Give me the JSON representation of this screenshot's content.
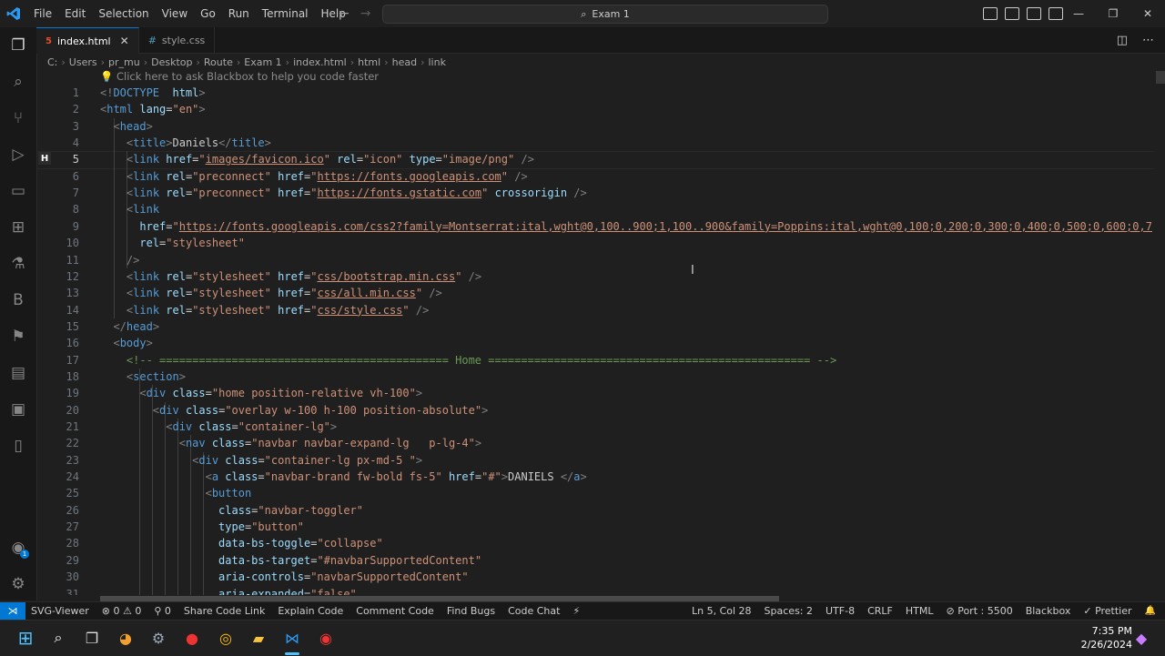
{
  "menu": [
    "File",
    "Edit",
    "Selection",
    "View",
    "Go",
    "Run",
    "Terminal",
    "Help"
  ],
  "search": {
    "text": "Exam 1"
  },
  "tabs": [
    {
      "label": "index.html",
      "active": true
    },
    {
      "label": "style.css",
      "active": false
    }
  ],
  "breadcrumb": [
    "C:",
    "Users",
    "pr_mu",
    "Desktop",
    "Route",
    "Exam 1",
    "index.html",
    "html",
    "head",
    "link"
  ],
  "blackbox_hint": "Click here to ask Blackbox to help you code faster",
  "lines": [
    {
      "n": "1",
      "segs": [
        [
          "p",
          "<!"
        ],
        [
          "t",
          "DOCTYPE"
        ],
        [
          "",
          "  "
        ],
        [
          "a",
          "html"
        ],
        [
          "p",
          ">"
        ]
      ]
    },
    {
      "n": "2",
      "segs": [
        [
          "p",
          "<"
        ],
        [
          "t",
          "html"
        ],
        [
          "",
          ""
        ],
        [
          "a",
          " lang"
        ],
        [
          "",
          "="
        ],
        [
          "s",
          "\"en\""
        ],
        [
          "p",
          ">"
        ]
      ]
    },
    {
      "n": "3",
      "segs": [
        [
          "",
          "  "
        ],
        [
          "p",
          "<"
        ],
        [
          "t",
          "head"
        ],
        [
          "p",
          ">"
        ]
      ]
    },
    {
      "n": "4",
      "segs": [
        [
          "",
          "    "
        ],
        [
          "p",
          "<"
        ],
        [
          "t",
          "title"
        ],
        [
          "p",
          ">"
        ],
        [
          "",
          "Daniels"
        ],
        [
          "p",
          "</"
        ],
        [
          "t",
          "title"
        ],
        [
          "p",
          ">"
        ]
      ]
    },
    {
      "n": "5",
      "segs": [
        [
          "",
          "    "
        ],
        [
          "p",
          "<"
        ],
        [
          "t",
          "link"
        ],
        [
          "a",
          " href"
        ],
        [
          "",
          "="
        ],
        [
          "s",
          "\""
        ],
        [
          "su",
          "images/favicon.ico"
        ],
        [
          "s",
          "\""
        ],
        [
          "a",
          " rel"
        ],
        [
          "",
          "="
        ],
        [
          "s",
          "\"icon\""
        ],
        [
          "a",
          " type"
        ],
        [
          "",
          "="
        ],
        [
          "s",
          "\"image/png\""
        ],
        [
          "p",
          " />"
        ]
      ]
    },
    {
      "n": "6",
      "segs": [
        [
          "",
          "    "
        ],
        [
          "p",
          "<"
        ],
        [
          "t",
          "link"
        ],
        [
          "a",
          " rel"
        ],
        [
          "",
          "="
        ],
        [
          "s",
          "\"preconnect\""
        ],
        [
          "a",
          " href"
        ],
        [
          "",
          "="
        ],
        [
          "s",
          "\""
        ],
        [
          "su",
          "https://fonts.googleapis.com"
        ],
        [
          "s",
          "\""
        ],
        [
          "p",
          " />"
        ]
      ]
    },
    {
      "n": "7",
      "segs": [
        [
          "",
          "    "
        ],
        [
          "p",
          "<"
        ],
        [
          "t",
          "link"
        ],
        [
          "a",
          " rel"
        ],
        [
          "",
          "="
        ],
        [
          "s",
          "\"preconnect\""
        ],
        [
          "a",
          " href"
        ],
        [
          "",
          "="
        ],
        [
          "s",
          "\""
        ],
        [
          "su",
          "https://fonts.gstatic.com"
        ],
        [
          "s",
          "\""
        ],
        [
          "a",
          " crossorigin"
        ],
        [
          "p",
          " />"
        ]
      ]
    },
    {
      "n": "8",
      "segs": [
        [
          "",
          "    "
        ],
        [
          "p",
          "<"
        ],
        [
          "t",
          "link"
        ]
      ]
    },
    {
      "n": "9",
      "segs": [
        [
          "",
          "      "
        ],
        [
          "a",
          "href"
        ],
        [
          "",
          "="
        ],
        [
          "s",
          "\""
        ],
        [
          "su",
          "https://fonts.googleapis.com/css2?family=Montserrat:ital,wght@0,100..900;1,100..900&family=Poppins:ital,wght@0,100;0,200;0,300;0,400;0,500;0,600;0,7"
        ]
      ]
    },
    {
      "n": "10",
      "segs": [
        [
          "",
          "      "
        ],
        [
          "a",
          "rel"
        ],
        [
          "",
          "="
        ],
        [
          "s",
          "\"stylesheet\""
        ]
      ]
    },
    {
      "n": "11",
      "segs": [
        [
          "",
          "    "
        ],
        [
          "p",
          "/>"
        ]
      ]
    },
    {
      "n": "12",
      "segs": [
        [
          "",
          "    "
        ],
        [
          "p",
          "<"
        ],
        [
          "t",
          "link"
        ],
        [
          "a",
          " rel"
        ],
        [
          "",
          "="
        ],
        [
          "s",
          "\"stylesheet\""
        ],
        [
          "a",
          " href"
        ],
        [
          "",
          "="
        ],
        [
          "s",
          "\""
        ],
        [
          "su",
          "css/bootstrap.min.css"
        ],
        [
          "s",
          "\""
        ],
        [
          "p",
          " />"
        ]
      ]
    },
    {
      "n": "13",
      "segs": [
        [
          "",
          "    "
        ],
        [
          "p",
          "<"
        ],
        [
          "t",
          "link"
        ],
        [
          "a",
          " rel"
        ],
        [
          "",
          "="
        ],
        [
          "s",
          "\"stylesheet\""
        ],
        [
          "a",
          " href"
        ],
        [
          "",
          "="
        ],
        [
          "s",
          "\""
        ],
        [
          "su",
          "css/all.min.css"
        ],
        [
          "s",
          "\""
        ],
        [
          "p",
          " />"
        ]
      ]
    },
    {
      "n": "14",
      "segs": [
        [
          "",
          "    "
        ],
        [
          "p",
          "<"
        ],
        [
          "t",
          "link"
        ],
        [
          "a",
          " rel"
        ],
        [
          "",
          "="
        ],
        [
          "s",
          "\"stylesheet\""
        ],
        [
          "a",
          " href"
        ],
        [
          "",
          "="
        ],
        [
          "s",
          "\""
        ],
        [
          "su",
          "css/style.css"
        ],
        [
          "s",
          "\""
        ],
        [
          "p",
          " />"
        ]
      ]
    },
    {
      "n": "15",
      "segs": [
        [
          "",
          "  "
        ],
        [
          "p",
          "</"
        ],
        [
          "t",
          "head"
        ],
        [
          "p",
          ">"
        ]
      ]
    },
    {
      "n": "16",
      "segs": [
        [
          "",
          "  "
        ],
        [
          "p",
          "<"
        ],
        [
          "t",
          "body"
        ],
        [
          "p",
          ">"
        ]
      ]
    },
    {
      "n": "17",
      "segs": [
        [
          "",
          "    "
        ],
        [
          "c",
          "<!-- ============================================ Home ================================================= -->"
        ]
      ]
    },
    {
      "n": "18",
      "segs": [
        [
          "",
          "    "
        ],
        [
          "p",
          "<"
        ],
        [
          "t",
          "section"
        ],
        [
          "p",
          ">"
        ]
      ]
    },
    {
      "n": "19",
      "segs": [
        [
          "",
          "      "
        ],
        [
          "p",
          "<"
        ],
        [
          "t",
          "div"
        ],
        [
          "a",
          " class"
        ],
        [
          "",
          "="
        ],
        [
          "s",
          "\"home position-relative vh-100\""
        ],
        [
          "p",
          ">"
        ]
      ]
    },
    {
      "n": "20",
      "segs": [
        [
          "",
          "        "
        ],
        [
          "p",
          "<"
        ],
        [
          "t",
          "div"
        ],
        [
          "a",
          " class"
        ],
        [
          "",
          "="
        ],
        [
          "s",
          "\"overlay w-100 h-100 position-absolute\""
        ],
        [
          "p",
          ">"
        ]
      ]
    },
    {
      "n": "21",
      "segs": [
        [
          "",
          "          "
        ],
        [
          "p",
          "<"
        ],
        [
          "t",
          "div"
        ],
        [
          "a",
          " class"
        ],
        [
          "",
          "="
        ],
        [
          "s",
          "\"container-lg\""
        ],
        [
          "p",
          ">"
        ]
      ]
    },
    {
      "n": "22",
      "segs": [
        [
          "",
          "            "
        ],
        [
          "p",
          "<"
        ],
        [
          "t",
          "nav"
        ],
        [
          "a",
          " class"
        ],
        [
          "",
          "="
        ],
        [
          "s",
          "\"navbar navbar-expand-lg   p-lg-4\""
        ],
        [
          "p",
          ">"
        ]
      ]
    },
    {
      "n": "23",
      "segs": [
        [
          "",
          "              "
        ],
        [
          "p",
          "<"
        ],
        [
          "t",
          "div"
        ],
        [
          "a",
          " class"
        ],
        [
          "",
          "="
        ],
        [
          "s",
          "\"container-lg px-md-5 \""
        ],
        [
          "p",
          ">"
        ]
      ]
    },
    {
      "n": "24",
      "segs": [
        [
          "",
          "                "
        ],
        [
          "p",
          "<"
        ],
        [
          "t",
          "a"
        ],
        [
          "a",
          " class"
        ],
        [
          "",
          "="
        ],
        [
          "s",
          "\"navbar-brand fw-bold fs-5\""
        ],
        [
          "a",
          " href"
        ],
        [
          "",
          "="
        ],
        [
          "s",
          "\"#\""
        ],
        [
          "p",
          ">"
        ],
        [
          "",
          "DANIELS "
        ],
        [
          "p",
          "</"
        ],
        [
          "t",
          "a"
        ],
        [
          "p",
          ">"
        ]
      ]
    },
    {
      "n": "25",
      "segs": [
        [
          "",
          "                "
        ],
        [
          "p",
          "<"
        ],
        [
          "t",
          "button"
        ]
      ]
    },
    {
      "n": "26",
      "segs": [
        [
          "",
          "                  "
        ],
        [
          "a",
          "class"
        ],
        [
          "",
          "="
        ],
        [
          "s",
          "\"navbar-toggler\""
        ]
      ]
    },
    {
      "n": "27",
      "segs": [
        [
          "",
          "                  "
        ],
        [
          "a",
          "type"
        ],
        [
          "",
          "="
        ],
        [
          "s",
          "\"button\""
        ]
      ]
    },
    {
      "n": "28",
      "segs": [
        [
          "",
          "                  "
        ],
        [
          "a",
          "data-bs-toggle"
        ],
        [
          "",
          "="
        ],
        [
          "s",
          "\"collapse\""
        ]
      ]
    },
    {
      "n": "29",
      "segs": [
        [
          "",
          "                  "
        ],
        [
          "a",
          "data-bs-target"
        ],
        [
          "",
          "="
        ],
        [
          "s",
          "\"#navbarSupportedContent\""
        ]
      ]
    },
    {
      "n": "30",
      "segs": [
        [
          "",
          "                  "
        ],
        [
          "a",
          "aria-controls"
        ],
        [
          "",
          "="
        ],
        [
          "s",
          "\"navbarSupportedContent\""
        ]
      ]
    },
    {
      "n": "31",
      "segs": [
        [
          "",
          "                  "
        ],
        [
          "a",
          "aria-expanded"
        ],
        [
          "",
          "="
        ],
        [
          "s",
          "\"false\""
        ]
      ]
    }
  ],
  "status": {
    "left": [
      "SVG-Viewer",
      "⊗ 0 ⚠ 0",
      "⚲ 0",
      "Share Code Link",
      "Explain Code",
      "Comment Code",
      "Find Bugs",
      "Code Chat"
    ],
    "right": [
      "Ln 5, Col 28",
      "Spaces: 2",
      "UTF-8",
      "CRLF",
      "HTML",
      "⊘ Port : 5500",
      "Blackbox",
      "✓ Prettier"
    ]
  },
  "clock": {
    "time": "7:35 PM",
    "date": "2/26/2024"
  },
  "colors": {
    "accent": "#0078d4",
    "tag": "#569cd6",
    "attr": "#9cdcfe",
    "string": "#ce9178",
    "comment": "#6a9955"
  }
}
